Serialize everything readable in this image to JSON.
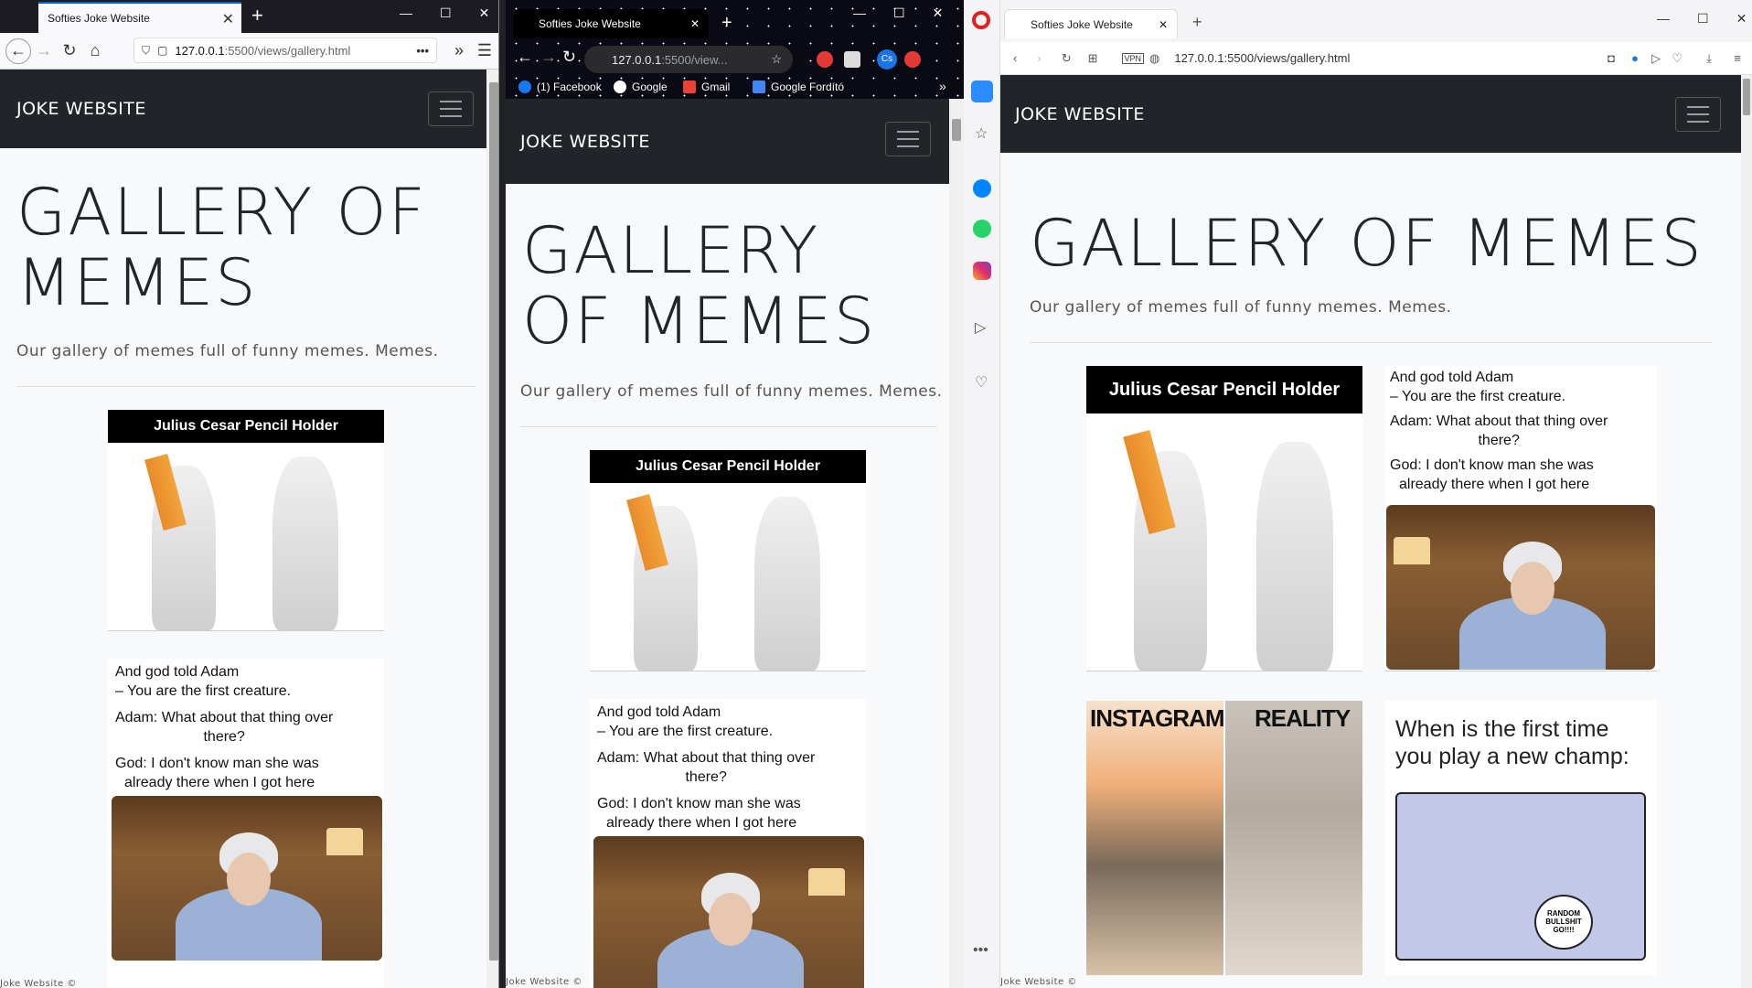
{
  "tab_title": "Softies Joke Website",
  "url": {
    "firefox_host": "127.0.0.1",
    "firefox_path": ":5500/views/gallery.html",
    "chrome_host": "127.0.0.1",
    "chrome_path": ":5500/view...",
    "opera": "127.0.0.1:5500/views/gallery.html"
  },
  "bookmarks": [
    "(1) Facebook",
    "Google",
    "Gmail",
    "Google Fordító"
  ],
  "page": {
    "brand": "JOKE WEBSITE",
    "title": "GALLERY OF MEMES",
    "title_line1_ff": "GALLERY OF",
    "title_line2_ff": "MEMES",
    "title_line1_ch": "GALLERY",
    "title_line2_ch": "OF MEMES",
    "lead": "Our gallery of memes full of funny memes. Memes.",
    "footer": "Joke Website ©"
  },
  "memes": {
    "pencil_title": "Julius Cesar Pencil Holder",
    "adam_1": "And god told Adam",
    "adam_2": "– You are the first creature.",
    "adam_3": "Adam: What about that thing over",
    "adam_4": "there?",
    "adam_5": "God: I don't know man she was",
    "adam_6": "already there when I got here",
    "insta_left": "INSTAGRAM",
    "insta_right": "REALITY",
    "champ_1": "When is the first time",
    "champ_2": "you play a new champ:",
    "champ_bubble": "RANDOM BULLSHIT GO!!!!"
  },
  "vpn_badge": "VPN",
  "profile_badge": "Cs",
  "colors": {
    "navbar": "#212529",
    "page_bg": "#f8f9fa",
    "firefox_tab_accent": "#0060df"
  }
}
